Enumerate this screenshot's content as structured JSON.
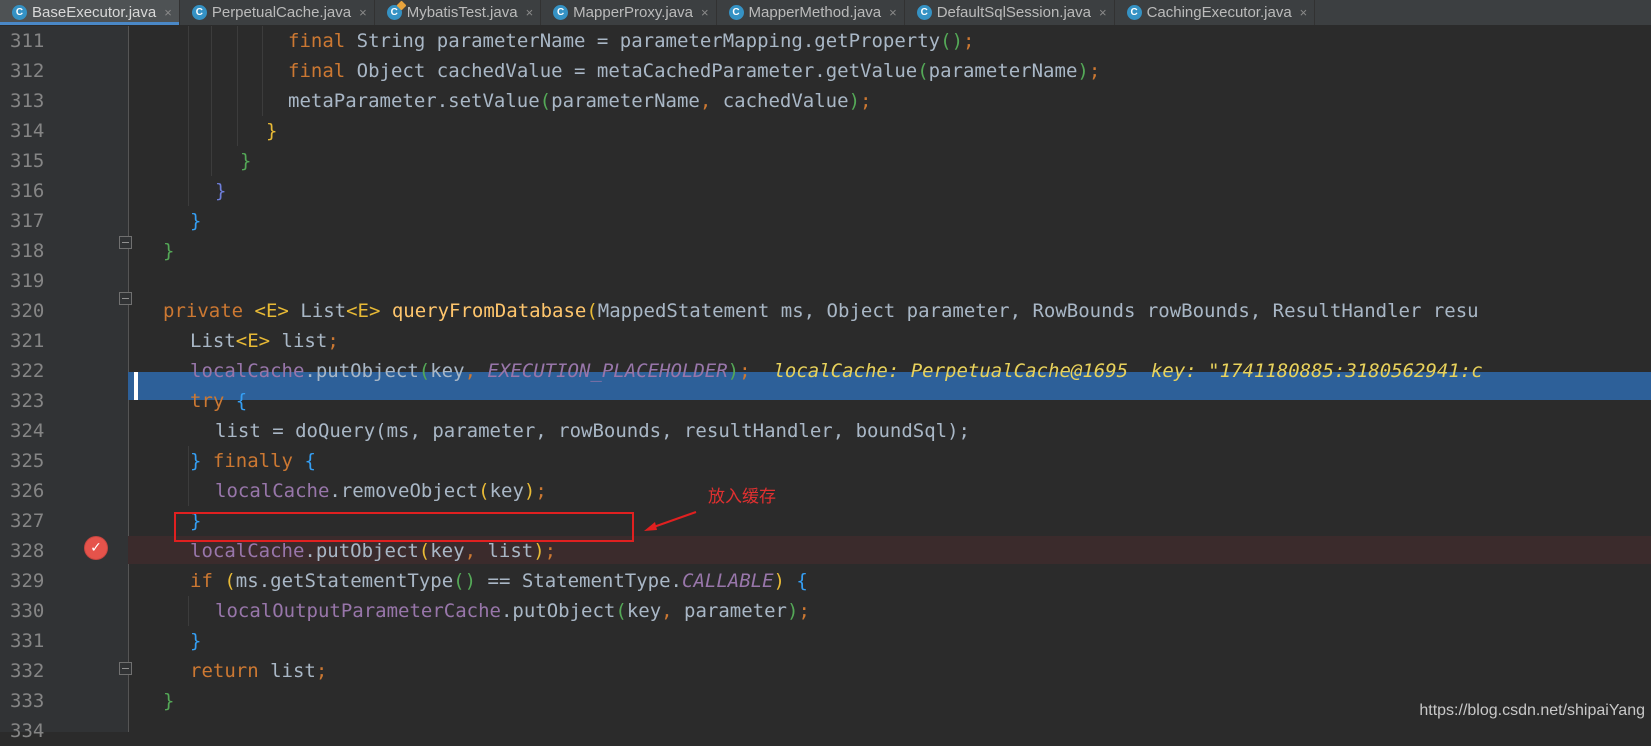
{
  "tabs": [
    {
      "label": "BaseExecutor.java",
      "active": true
    },
    {
      "label": "PerpetualCache.java"
    },
    {
      "label": "MybatisTest.java",
      "runnable": true
    },
    {
      "label": "MapperProxy.java"
    },
    {
      "label": "MapperMethod.java"
    },
    {
      "label": "DefaultSqlSession.java"
    },
    {
      "label": "CachingExecutor.java"
    }
  ],
  "tab_icon_letter": "C",
  "close_glyph": "×",
  "editor": {
    "lines": [
      {
        "num": "311"
      },
      {
        "num": "312"
      },
      {
        "num": "313"
      },
      {
        "num": "314"
      },
      {
        "num": "315"
      },
      {
        "num": "316"
      },
      {
        "num": "317"
      },
      {
        "num": "318"
      },
      {
        "num": "319"
      },
      {
        "num": "320"
      },
      {
        "num": "321"
      },
      {
        "num": "322"
      },
      {
        "num": "323"
      },
      {
        "num": "324"
      },
      {
        "num": "325"
      },
      {
        "num": "326"
      },
      {
        "num": "327"
      },
      {
        "num": "328"
      },
      {
        "num": "329"
      },
      {
        "num": "330"
      },
      {
        "num": "331"
      },
      {
        "num": "332"
      },
      {
        "num": "333"
      },
      {
        "num": "334"
      }
    ],
    "tokens": {
      "final": "final",
      "String": "String",
      "Object": "Object",
      "parameterName": "parameterName",
      "eq": " = ",
      "parameterMapping": "parameterMapping",
      "getProperty": ".getProperty",
      "cachedValue": "cachedValue",
      "metaCachedParameter": "metaCachedParameter",
      "getValue": ".getValue",
      "metaParameter": "metaParameter",
      "setValue": ".setValue",
      "comma": ", ",
      "semi": ";",
      "lp": "(",
      "rp": ")",
      "lb": "{",
      "rb": "}",
      "private": "private",
      "gen_E": "<E>",
      "List": "List",
      "queryFromDatabase": "queryFromDatabase",
      "sig_params": "MappedStatement ms, Object parameter, RowBounds rowBounds, ResultHandler resu",
      "list": "list",
      "localCache": "localCache",
      "putObject": ".putObject",
      "key": "key",
      "EXECUTION_PLACEHOLDER": "EXECUTION_PLACEHOLDER",
      "try": "try",
      "doQuery_line": "list = doQuery(ms, parameter, rowBounds, resultHandler, boundSql);",
      "finally": "finally",
      "removeObject": ".removeObject",
      "if": "if",
      "ms": "ms",
      "getStatementType": ".getStatementType",
      "eqeq": " == ",
      "StatementType": "StatementType",
      "CALLABLE": "CALLABLE",
      "localOutputParameterCache": "localOutputParameterCache",
      "parameter": "parameter",
      "return": "return"
    },
    "debug_inline": "localCache: PerpetualCache@1695  key: \"1741180885:3180562941:c"
  },
  "annotation": {
    "label": "放入缓存",
    "color": "#e02020"
  },
  "watermark": "https://blog.csdn.net/shipaiYang"
}
